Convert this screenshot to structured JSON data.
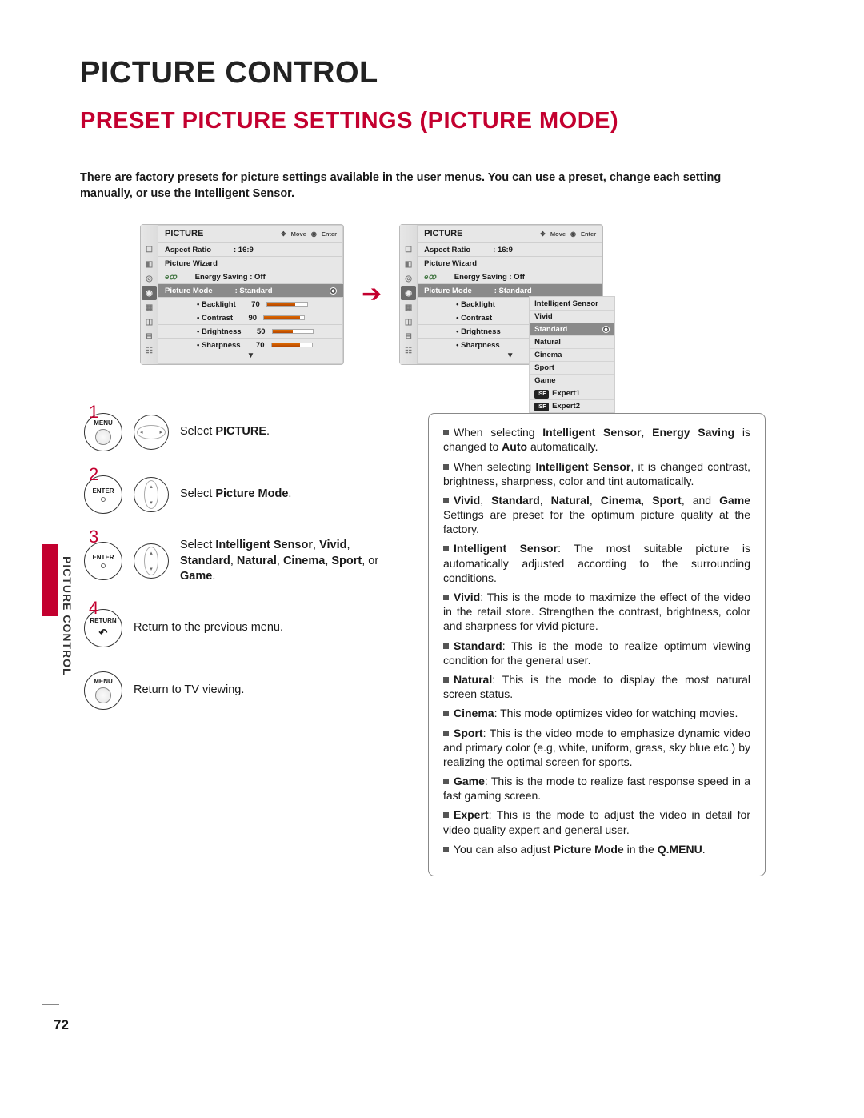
{
  "page_title": "PICTURE CONTROL",
  "subtitle": "PRESET PICTURE SETTINGS (PICTURE MODE)",
  "side_tab": "PICTURE CONTROL",
  "page_number": "72",
  "intro": "There are factory presets for picture settings available in the user menus. You can use a preset, change each setting manually, or use the Intelligent Sensor.",
  "osd1": {
    "title": "PICTURE",
    "hints": {
      "move": "Move",
      "enter": "Enter"
    },
    "aspect_label": "Aspect Ratio",
    "aspect_value": ": 16:9",
    "wizard": "Picture Wizard",
    "energy_label": "Energy Saving : Off",
    "mode_label": "Picture Mode",
    "mode_value": ": Standard",
    "params": [
      {
        "name": "Backlight",
        "val": "70",
        "pct": 70
      },
      {
        "name": "Contrast",
        "val": "90",
        "pct": 90
      },
      {
        "name": "Brightness",
        "val": "50",
        "pct": 50
      },
      {
        "name": "Sharpness",
        "val": "70",
        "pct": 70
      }
    ]
  },
  "osd2": {
    "title": "PICTURE",
    "dropdown": [
      "Intelligent Sensor",
      "Vivid",
      "Standard",
      "Natural",
      "Cinema",
      "Sport",
      "Game",
      "Expert1",
      "Expert2"
    ],
    "selected": "Standard"
  },
  "steps": [
    {
      "num": "1",
      "btn": "MENU",
      "nav": "h",
      "text_html": "Select <b>PICTURE</b>."
    },
    {
      "num": "2",
      "btn": "ENTER",
      "nav": "v",
      "text_html": "Select <b>Picture Mode</b>."
    },
    {
      "num": "3",
      "btn": "ENTER",
      "nav": "v",
      "text_html": "Select <b>Intelligent Sensor</b>, <b>Vivid</b>, <b>Standard</b>, <b>Natural</b>, <b>Cinema</b>, <b>Sport</b>, or <b>Game</b>."
    },
    {
      "num": "4",
      "btn": "RETURN",
      "nav": "",
      "text_html": "Return to the previous menu."
    },
    {
      "num": "",
      "btn": "MENU",
      "nav": "",
      "text_html": "Return to TV viewing."
    }
  ],
  "info": [
    "When selecting <b>Intelligent Sensor</b>, <b>Energy Saving</b> is changed to <b>Auto</b> automatically.",
    "When selecting <b>Intelligent Sensor</b>, it is changed contrast, brightness, sharpness, color and tint automatically.",
    "<b>Vivid</b>, <b>Standard</b>, <b>Natural</b>, <b>Cinema</b>, <b>Sport</b>, and <b>Game</b> Settings are preset for the optimum picture quality at the factory.",
    "<b>Intelligent Sensor</b>: The most suitable picture is automatically adjusted according to the surrounding conditions.",
    "<b>Vivid</b>: This is the mode to maximize the effect of the video in the retail store. Strengthen the contrast, brightness, color and sharpness for vivid picture.",
    "<b>Standard</b>: This is the mode to realize optimum viewing condition for the general user.",
    "<b>Natural</b>: This is the mode to display the most natural screen status.",
    "<b>Cinema</b>: This mode optimizes video for watching movies.",
    "<b>Sport</b>: This is the video mode to emphasize dynamic video and primary color (e.g, white, uniform, grass, sky blue etc.) by realizing the optimal screen for sports.",
    "<b>Game</b>: This is the mode to realize fast response speed in a fast gaming screen.",
    "<b>Expert</b>: This is the mode to adjust the video in detail for video quality expert and general user.",
    "You can also adjust <b>Picture Mode</b> in the <b>Q.MENU</b>."
  ]
}
